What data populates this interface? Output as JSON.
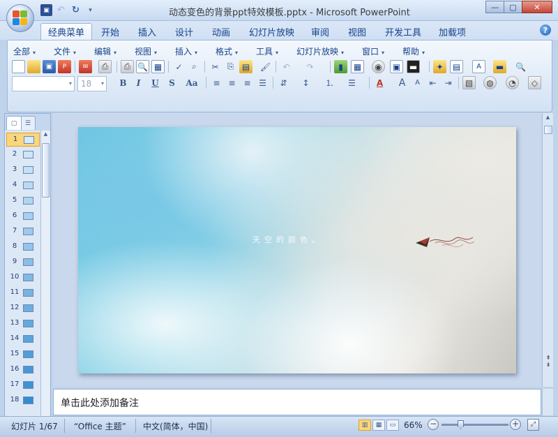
{
  "window": {
    "title": "动态变色的背景ppt特效模板.pptx - Microsoft PowerPoint",
    "controls": {
      "minimize": "—",
      "maximize": "▢",
      "close": "✕"
    }
  },
  "quick_access": {
    "save_icon": "save-icon",
    "undo_icon": "undo-icon",
    "redo_icon": "redo-icon"
  },
  "tabs": [
    {
      "label": "经典菜单",
      "active": true
    },
    {
      "label": "开始"
    },
    {
      "label": "插入"
    },
    {
      "label": "设计"
    },
    {
      "label": "动画"
    },
    {
      "label": "幻灯片放映"
    },
    {
      "label": "审阅"
    },
    {
      "label": "视图"
    },
    {
      "label": "开发工具"
    },
    {
      "label": "加载项"
    }
  ],
  "menus": [
    {
      "label": "全部"
    },
    {
      "label": "文件"
    },
    {
      "label": "编辑"
    },
    {
      "label": "视图"
    },
    {
      "label": "插入"
    },
    {
      "label": "格式"
    },
    {
      "label": "工具"
    },
    {
      "label": "幻灯片放映"
    },
    {
      "label": "窗口"
    },
    {
      "label": "帮助"
    }
  ],
  "format_bar": {
    "font_name": "",
    "font_size": "18",
    "bold": "B",
    "italic": "I",
    "underline": "U",
    "shadow": "S",
    "change_case": "Aa"
  },
  "slides": {
    "count": 67,
    "current": 1,
    "visible_numbers": [
      "1",
      "2",
      "3",
      "4",
      "5",
      "6",
      "7",
      "8",
      "9",
      "10",
      "11",
      "12",
      "13",
      "14",
      "15",
      "16",
      "17",
      "18"
    ]
  },
  "slide_content": {
    "caption": "天空的颜色。"
  },
  "notes": {
    "placeholder": "单击此处添加备注"
  },
  "status": {
    "slide_info": "幻灯片 1/67",
    "theme": "“Office 主题”",
    "language": "中文(简体，中国)",
    "zoom": "66%"
  },
  "colors": {
    "ribbon_bg": "#dfeaf7",
    "accent": "#15428b",
    "selection": "#fbd67a"
  }
}
